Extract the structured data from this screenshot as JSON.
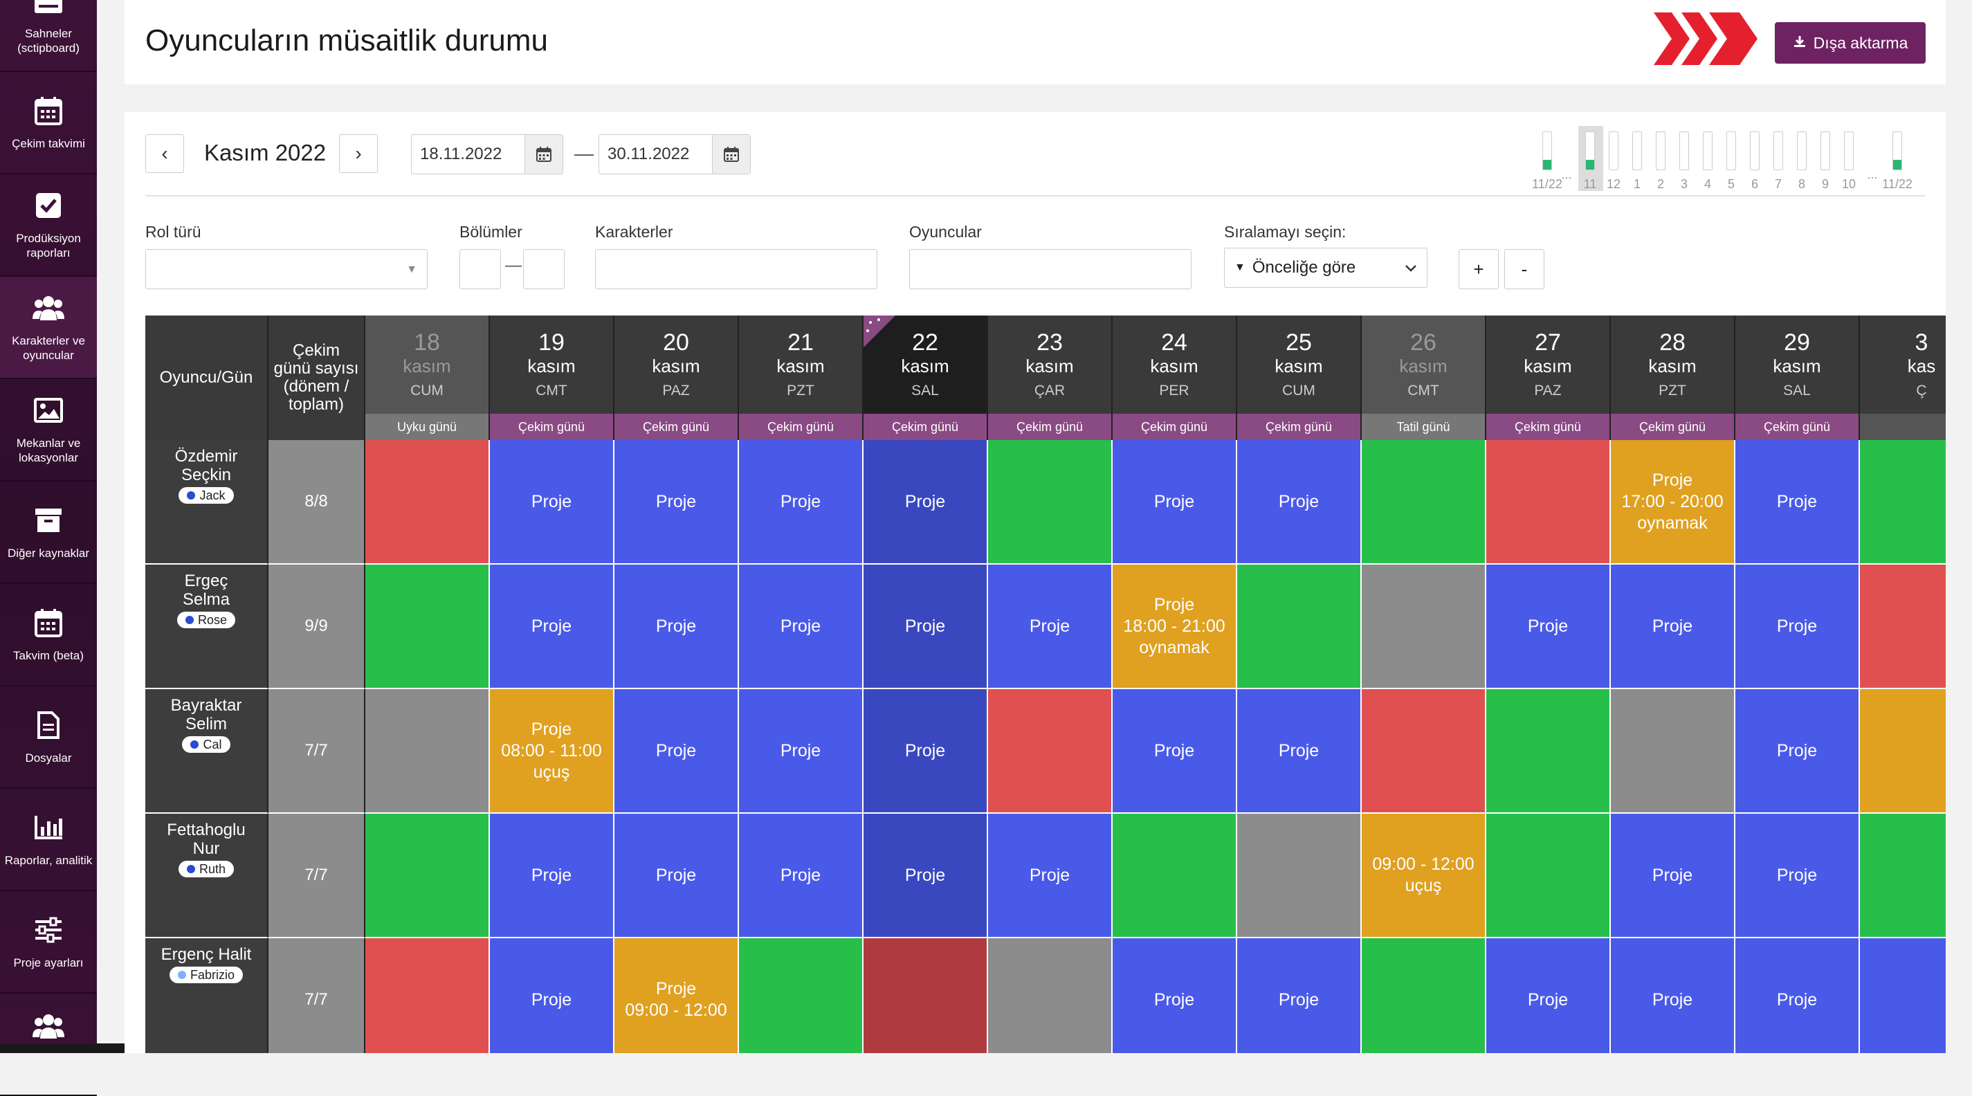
{
  "sidebar": {
    "items": [
      {
        "label": "Sahneler (sctipboard)",
        "icon": "clapper-icon"
      },
      {
        "label": "Çekim takvimi",
        "icon": "calendar-icon"
      },
      {
        "label": "Prodüksiyon raporları",
        "icon": "checkbox-icon"
      },
      {
        "label": "Karakterler ve oyuncular",
        "icon": "users-icon"
      },
      {
        "label": "Mekanlar ve lokasyonlar",
        "icon": "image-icon"
      },
      {
        "label": "Diğer kaynaklar",
        "icon": "archive-icon"
      },
      {
        "label": "Takvim (beta)",
        "icon": "calendar-icon"
      },
      {
        "label": "Dosyalar",
        "icon": "document-icon"
      },
      {
        "label": "Raporlar, analitik",
        "icon": "bar-chart-icon"
      },
      {
        "label": "Proje ayarları",
        "icon": "sliders-icon"
      },
      {
        "label": "",
        "icon": "users-icon"
      }
    ]
  },
  "header": {
    "title": "Oyuncuların müsaitlik durumu",
    "export_label": "Dışa aktarma"
  },
  "toolbar": {
    "prev": "‹",
    "next": "›",
    "month": "Kasım 2022",
    "date_from": "18.11.2022",
    "date_to": "30.11.2022",
    "dash": "—"
  },
  "timeline": {
    "labels": [
      "11/22",
      "...",
      "11",
      "12",
      "1",
      "2",
      "3",
      "4",
      "5",
      "6",
      "7",
      "8",
      "9",
      "10",
      "...",
      "11/22"
    ],
    "selected_index": 1
  },
  "filters": {
    "role_type_label": "Rol türü",
    "episodes_label": "Bölümler",
    "episodes_dash": "—",
    "characters_label": "Karakterler",
    "actors_label": "Oyuncular",
    "sort_label": "Sıralamayı seçin:",
    "sort_value": "Önceliğe göre",
    "plus": "+",
    "minus": "-"
  },
  "colors": {
    "red": "#e05050",
    "blue": "#4a5ae8",
    "blue_today": "#3a48bf",
    "green": "#27bf4a",
    "grey": "#8c8c8c",
    "orange": "#e0a020",
    "darkred": "#b03b3e",
    "type_bar": "#8a4a84",
    "accent": "#6e2262"
  },
  "grid": {
    "actor_header": "Oyuncu/Gün",
    "count_header": "Çekim günü sayısı (dönem / toplam)",
    "days": [
      {
        "num": "18",
        "month": "kasım",
        "weekday": "CUM",
        "type": "Uyku günü",
        "muted": true
      },
      {
        "num": "19",
        "month": "kasım",
        "weekday": "CMT",
        "type": "Çekim günü",
        "muted": false
      },
      {
        "num": "20",
        "month": "kasım",
        "weekday": "PAZ",
        "type": "Çekim günü",
        "muted": false
      },
      {
        "num": "21",
        "month": "kasım",
        "weekday": "PZT",
        "type": "Çekim günü",
        "muted": false
      },
      {
        "num": "22",
        "month": "kasım",
        "weekday": "SAL",
        "type": "Çekim günü",
        "muted": false,
        "today": true
      },
      {
        "num": "23",
        "month": "kasım",
        "weekday": "ÇAR",
        "type": "Çekim günü",
        "muted": false
      },
      {
        "num": "24",
        "month": "kasım",
        "weekday": "PER",
        "type": "Çekim günü",
        "muted": false
      },
      {
        "num": "25",
        "month": "kasım",
        "weekday": "CUM",
        "type": "Çekim günü",
        "muted": false
      },
      {
        "num": "26",
        "month": "kasım",
        "weekday": "CMT",
        "type": "Tatil günü",
        "muted": true
      },
      {
        "num": "27",
        "month": "kasım",
        "weekday": "PAZ",
        "type": "Çekim günü",
        "muted": false
      },
      {
        "num": "28",
        "month": "kasım",
        "weekday": "PZT",
        "type": "Çekim günü",
        "muted": false
      },
      {
        "num": "29",
        "month": "kasım",
        "weekday": "SAL",
        "type": "Çekim günü",
        "muted": false
      },
      {
        "num": "3",
        "month": "kas",
        "weekday": "Ç",
        "type": "",
        "muted": false
      }
    ],
    "rows": [
      {
        "name": "Özdemir Seçkin",
        "role": "Jack",
        "role_dot": "#2a4ad0",
        "count": "8/8",
        "cells": [
          [
            "red",
            ""
          ],
          [
            "blue",
            "Proje"
          ],
          [
            "blue",
            "Proje"
          ],
          [
            "blue",
            "Proje"
          ],
          [
            "blue_today",
            "Proje"
          ],
          [
            "green",
            ""
          ],
          [
            "blue",
            "Proje"
          ],
          [
            "blue",
            "Proje"
          ],
          [
            "green",
            ""
          ],
          [
            "red",
            ""
          ],
          [
            "orange",
            "Proje\n17:00 - 20:00\noynamak"
          ],
          [
            "blue",
            "Proje"
          ],
          [
            "green",
            ""
          ]
        ]
      },
      {
        "name": "Ergeç Selma",
        "role": "Rose",
        "role_dot": "#2a4ad0",
        "count": "9/9",
        "cells": [
          [
            "green",
            ""
          ],
          [
            "blue",
            "Proje"
          ],
          [
            "blue",
            "Proje"
          ],
          [
            "blue",
            "Proje"
          ],
          [
            "blue_today",
            "Proje"
          ],
          [
            "blue",
            "Proje"
          ],
          [
            "orange",
            "Proje\n18:00 - 21:00\noynamak"
          ],
          [
            "green",
            ""
          ],
          [
            "grey",
            ""
          ],
          [
            "blue",
            "Proje"
          ],
          [
            "blue",
            "Proje"
          ],
          [
            "blue",
            "Proje"
          ],
          [
            "red",
            ""
          ]
        ]
      },
      {
        "name": "Bayraktar Selim",
        "role": "Cal",
        "role_dot": "#2a4ad0",
        "count": "7/7",
        "cells": [
          [
            "grey",
            ""
          ],
          [
            "orange",
            "Proje\n08:00 - 11:00\nuçuş"
          ],
          [
            "blue",
            "Proje"
          ],
          [
            "blue",
            "Proje"
          ],
          [
            "blue_today",
            "Proje"
          ],
          [
            "red",
            ""
          ],
          [
            "blue",
            "Proje"
          ],
          [
            "blue",
            "Proje"
          ],
          [
            "red",
            ""
          ],
          [
            "green",
            ""
          ],
          [
            "grey",
            ""
          ],
          [
            "blue",
            "Proje"
          ],
          [
            "orange",
            ""
          ]
        ]
      },
      {
        "name": "Fettahoglu Nur",
        "role": "Ruth",
        "role_dot": "#2a4ad0",
        "count": "7/7",
        "cells": [
          [
            "green",
            ""
          ],
          [
            "blue",
            "Proje"
          ],
          [
            "blue",
            "Proje"
          ],
          [
            "blue",
            "Proje"
          ],
          [
            "blue_today",
            "Proje"
          ],
          [
            "blue",
            "Proje"
          ],
          [
            "green",
            ""
          ],
          [
            "grey",
            ""
          ],
          [
            "orange",
            "09:00 - 12:00\nuçuş"
          ],
          [
            "green",
            ""
          ],
          [
            "blue",
            "Proje"
          ],
          [
            "blue",
            "Proje"
          ],
          [
            "green",
            ""
          ]
        ]
      },
      {
        "name": "Ergenç Halit",
        "role": "Fabrizio",
        "role_dot": "#7fb0ff",
        "count": "7/7",
        "cells": [
          [
            "red",
            ""
          ],
          [
            "blue",
            "Proje"
          ],
          [
            "orange",
            "Proje\n09:00 - 12:00"
          ],
          [
            "green",
            ""
          ],
          [
            "darkred",
            ""
          ],
          [
            "grey",
            ""
          ],
          [
            "blue",
            "Proje"
          ],
          [
            "blue",
            "Proje"
          ],
          [
            "green",
            ""
          ],
          [
            "blue",
            "Proje"
          ],
          [
            "blue",
            "Proje"
          ],
          [
            "blue",
            "Proje"
          ],
          [
            "blue",
            ""
          ]
        ]
      }
    ]
  }
}
